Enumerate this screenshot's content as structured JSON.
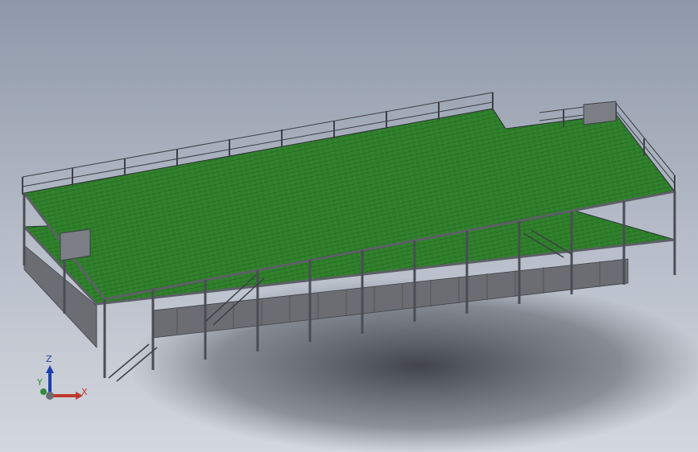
{
  "viewport": {
    "background_top": "#8e98a8",
    "background_bottom": "#d3d7de"
  },
  "model": {
    "grating_color": "#2f7f2b",
    "steel_color": "#5c5f66",
    "tank_color": "#6b6d72",
    "railing_color": "#3c3f45"
  },
  "triad": {
    "x_label": "X",
    "y_label": "Y",
    "z_label": "Z",
    "x_color": "#c0392b",
    "y_color": "#2e8b3e",
    "z_color": "#1f3fa8"
  }
}
